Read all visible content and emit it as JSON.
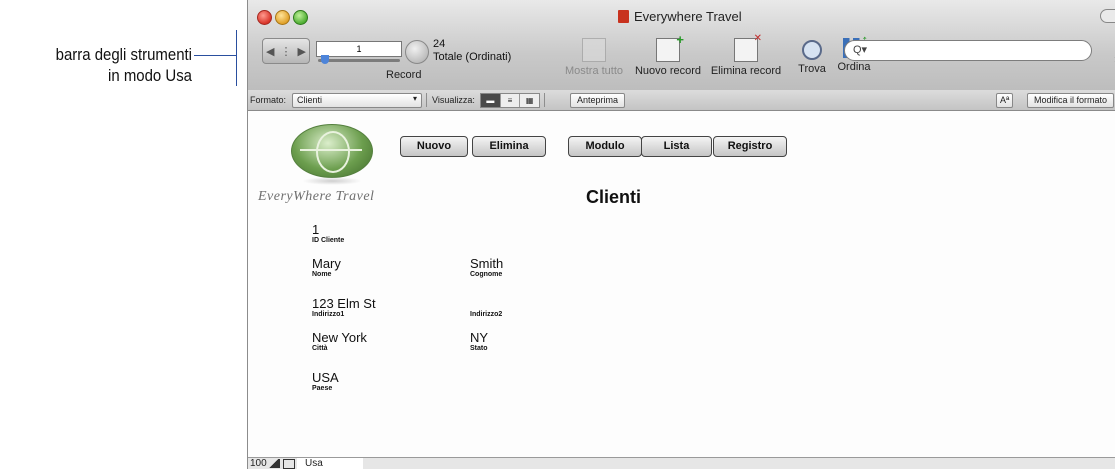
{
  "callout": {
    "line1": "barra degli strumenti",
    "line2": "in modo Usa"
  },
  "window": {
    "title": "Everywhere Travel"
  },
  "toolbar": {
    "record_number": "1",
    "total_count": "24",
    "total_label": "Totale (Ordinati)",
    "record_label": "Record",
    "buttons": [
      {
        "label": "Mostra tutto",
        "icon": "show-all-icon",
        "enabled": false
      },
      {
        "label": "Nuovo record",
        "icon": "new-record-icon",
        "enabled": true
      },
      {
        "label": "Elimina record",
        "icon": "delete-record-icon",
        "enabled": true
      },
      {
        "label": "Trova",
        "icon": "find-icon",
        "enabled": true
      },
      {
        "label": "Ordina",
        "icon": "sort-icon",
        "enabled": true
      }
    ],
    "search_placeholder": "Q▾"
  },
  "formatbar": {
    "format_label": "Formato:",
    "format_value": "Clienti",
    "view_label": "Visualizza:",
    "preview_button": "Anteprima",
    "text_button": "Aª",
    "edit_layout_button": "Modifica il formato"
  },
  "layout": {
    "brand": "EveryWhere Travel",
    "title": "Clienti",
    "buttons": [
      "Nuovo",
      "Elimina",
      "Modulo",
      "Lista",
      "Registro"
    ],
    "fields": {
      "id_cliente": {
        "value": "1",
        "label": "ID Cliente"
      },
      "nome": {
        "value": "Mary",
        "label": "Nome"
      },
      "cognome": {
        "value": "Smith",
        "label": "Cognome"
      },
      "indirizzo1": {
        "value": "123 Elm St",
        "label": "Indirizzo1"
      },
      "indirizzo2": {
        "value": "",
        "label": "Indirizzo2"
      },
      "citta": {
        "value": "New York",
        "label": "Città"
      },
      "stato": {
        "value": "NY",
        "label": "Stato"
      },
      "paese": {
        "value": "USA",
        "label": "Paese"
      }
    }
  },
  "statusbar": {
    "zoom": "100",
    "mode": "Usa"
  }
}
